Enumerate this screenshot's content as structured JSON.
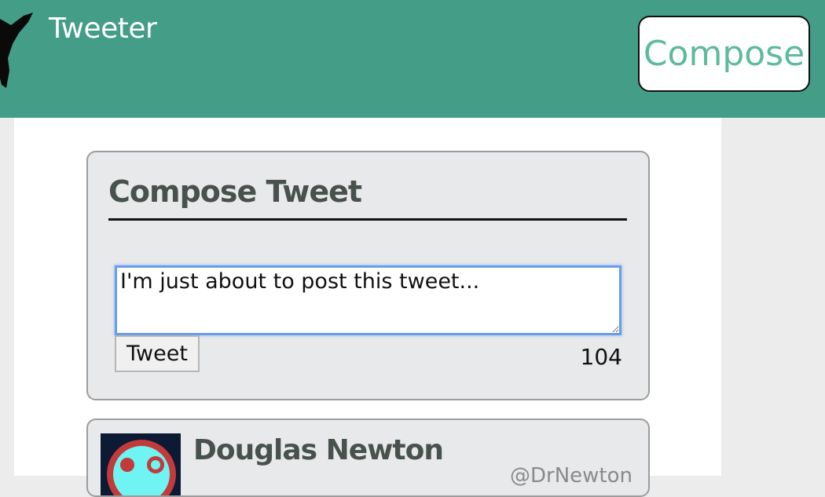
{
  "header": {
    "app_title": "Tweeter",
    "compose_button_label": "Compose",
    "background_color": "#449d87",
    "accent_color": "#5dbb9b",
    "logo_icon": "bird-silhouette-icon"
  },
  "compose": {
    "heading": "Compose Tweet",
    "input_value": "I'm just about to post this tweet...",
    "submit_label": "Tweet",
    "char_count": "104"
  },
  "tweets": [
    {
      "author_name": "Douglas Newton",
      "handle": "@DrNewton",
      "avatar_icon": "robot-avatar-icon"
    }
  ]
}
